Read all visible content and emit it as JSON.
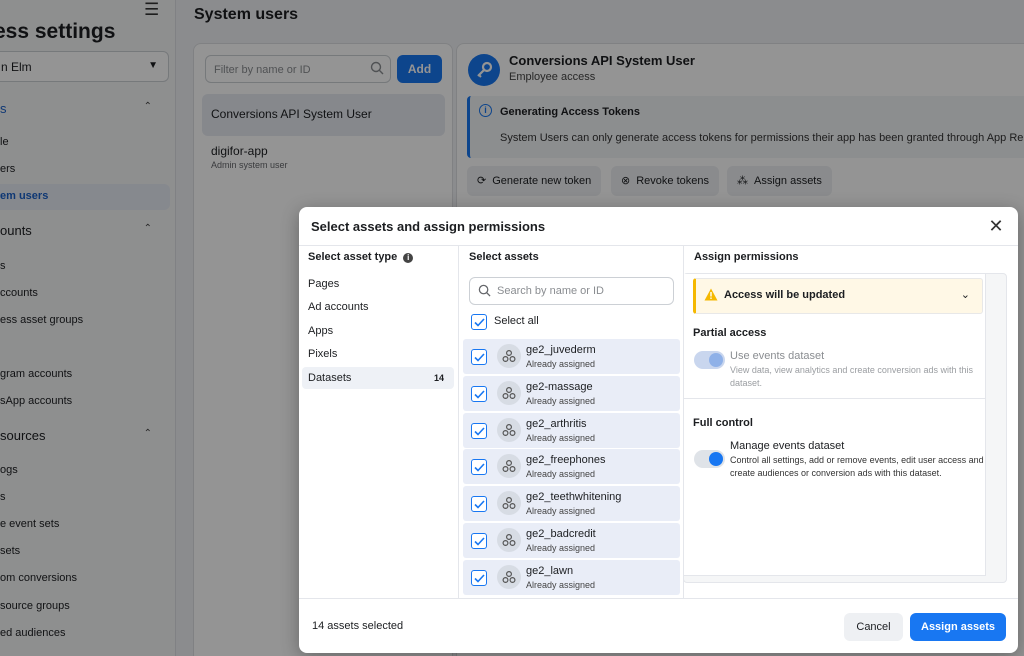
{
  "sidebar": {
    "title": "ess settings",
    "business_select": "n Elm",
    "rows": [
      {
        "label": "s",
        "kind": "head",
        "chevron": true,
        "link": true
      },
      {
        "label": "le"
      },
      {
        "label": "ers"
      },
      {
        "label": "em users",
        "selected": true
      },
      {
        "label": "ounts",
        "kind": "head",
        "chevron": true
      },
      {
        "label": "s"
      },
      {
        "label": "ccounts"
      },
      {
        "label": "ess asset groups"
      },
      {
        "label": ""
      },
      {
        "label": "gram accounts"
      },
      {
        "label": "sApp accounts"
      },
      {
        "label": " sources",
        "kind": "head",
        "chevron": true
      },
      {
        "label": "ogs"
      },
      {
        "label": "s"
      },
      {
        "label": "e event sets"
      },
      {
        "label": "sets"
      },
      {
        "label": "om conversions"
      },
      {
        "label": " source groups"
      },
      {
        "label": "ed audiences"
      }
    ]
  },
  "main": {
    "title": "System users",
    "filter_placeholder": "Filter by name or ID",
    "add_label": "Add",
    "users": [
      {
        "name": "Conversions API System User",
        "sub": "",
        "selected": true
      },
      {
        "name": "digifor-app",
        "sub": "Admin system user",
        "selected": false
      }
    ]
  },
  "detail": {
    "name": "Conversions API System User",
    "role": "Employee access",
    "notice_title": "Generating Access Tokens",
    "notice_text": "System Users can only generate access tokens for permissions their app has been granted through App Re",
    "actions": [
      {
        "label": "Generate new token",
        "icon": "refresh-icon"
      },
      {
        "label": "Revoke tokens",
        "icon": "revoke-icon"
      },
      {
        "label": "Assign assets",
        "icon": "assets-icon"
      }
    ]
  },
  "modal": {
    "title": "Select assets and assign permissions",
    "col1_header": "Select asset type",
    "col2_header": "Select assets",
    "col3_header": "Assign permissions",
    "asset_types": [
      {
        "label": "Pages",
        "count": ""
      },
      {
        "label": "Ad accounts",
        "count": ""
      },
      {
        "label": "Apps",
        "count": ""
      },
      {
        "label": "Pixels",
        "count": ""
      },
      {
        "label": "Datasets",
        "count": "14",
        "selected": true
      }
    ],
    "search_placeholder": "Search by name or ID",
    "select_all_label": "Select all",
    "assets": [
      {
        "name": "ge2_juvederm",
        "status": "Already assigned"
      },
      {
        "name": "ge2-massage",
        "status": "Already assigned"
      },
      {
        "name": "ge2_arthritis",
        "status": "Already assigned"
      },
      {
        "name": "ge2_freephones",
        "status": "Already assigned"
      },
      {
        "name": "ge2_teethwhitening",
        "status": "Already assigned"
      },
      {
        "name": "ge2_badcredit",
        "status": "Already assigned"
      },
      {
        "name": "ge2_lawn",
        "status": "Already assigned"
      }
    ],
    "permissions": {
      "warning": "Access will be updated",
      "partial_header": "Partial access",
      "partial_title": "Use events dataset",
      "partial_desc": "View data, view analytics and create conversion ads with this dataset.",
      "full_header": "Full control",
      "full_title": "Manage events dataset",
      "full_desc": "Control all settings, add or remove events, edit user access and create audiences or conversion ads with this dataset."
    },
    "footer_count": "14 assets selected",
    "cancel_label": "Cancel",
    "assign_label": "Assign assets"
  },
  "colors": {
    "accent": "#1877f2",
    "warning": "#f5b800",
    "selected_row": "#e9edf7"
  }
}
